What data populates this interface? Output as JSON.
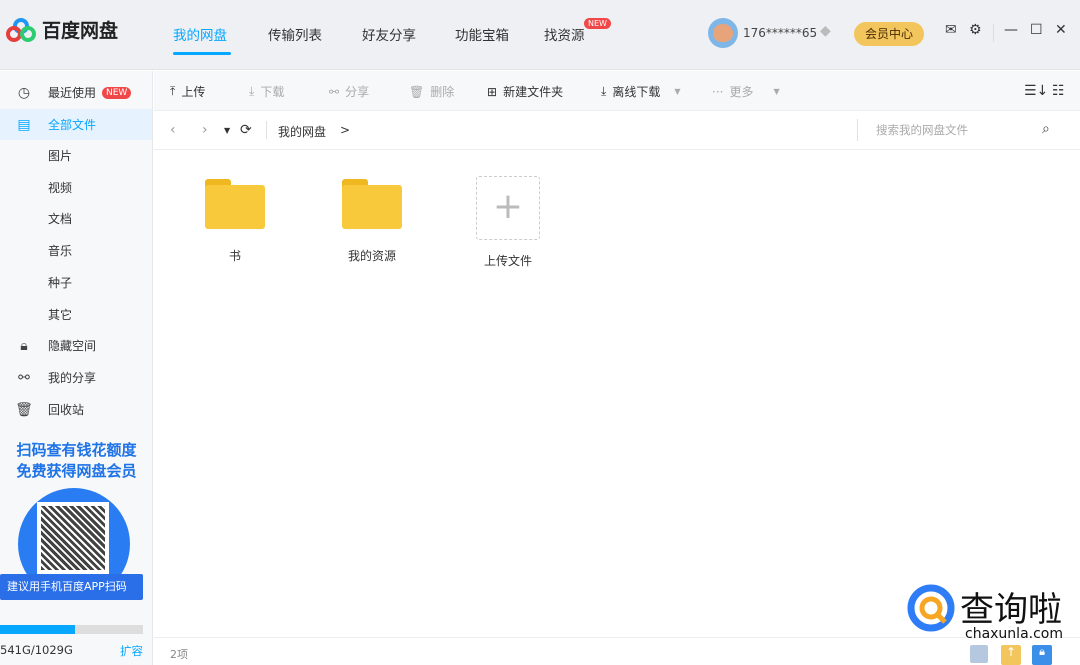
{
  "app": {
    "name": "百度网盘"
  },
  "nav": {
    "tabs": [
      {
        "label": "我的网盘"
      },
      {
        "label": "传输列表"
      },
      {
        "label": "好友分享"
      },
      {
        "label": "功能宝箱"
      },
      {
        "label": "找资源",
        "badge": "NEW"
      }
    ]
  },
  "user": {
    "name": "176******65",
    "vip_label": "会员中心"
  },
  "sidebar": {
    "items": [
      {
        "label": "最近使用",
        "badge": "NEW",
        "icon": "clock-icon"
      },
      {
        "label": "全部文件",
        "icon": "file-icon"
      },
      {
        "label": "图片"
      },
      {
        "label": "视频"
      },
      {
        "label": "文档"
      },
      {
        "label": "音乐"
      },
      {
        "label": "种子"
      },
      {
        "label": "其它"
      },
      {
        "label": "隐藏空间",
        "icon": "lock-icon"
      },
      {
        "label": "我的分享",
        "icon": "share-icon"
      },
      {
        "label": "回收站",
        "icon": "trash-icon"
      }
    ],
    "promo": {
      "line1": "扫码查有钱花额度",
      "line2": "免费获得网盘会员",
      "bar": "建议用手机百度APP扫码"
    },
    "storage": {
      "text": "541G/1029G",
      "used_fraction": 0.526,
      "expand": "扩容"
    }
  },
  "toolbar": {
    "upload": "上传",
    "download": "下载",
    "share": "分享",
    "delete": "删除",
    "new_folder": "新建文件夹",
    "offline": "离线下载",
    "more": "更多"
  },
  "breadcrumb": {
    "root": "我的网盘",
    "sep": ">"
  },
  "search": {
    "placeholder": "搜索我的网盘文件"
  },
  "files": [
    {
      "name": "书"
    },
    {
      "name": "我的资源"
    }
  ],
  "upload_tile": "上传文件",
  "status": {
    "count": "2项"
  },
  "watermark": {
    "title": "查询啦",
    "url": "chaxunla.com"
  },
  "colors": {
    "accent": "#06a7ff",
    "vip": "#f3c55d"
  }
}
